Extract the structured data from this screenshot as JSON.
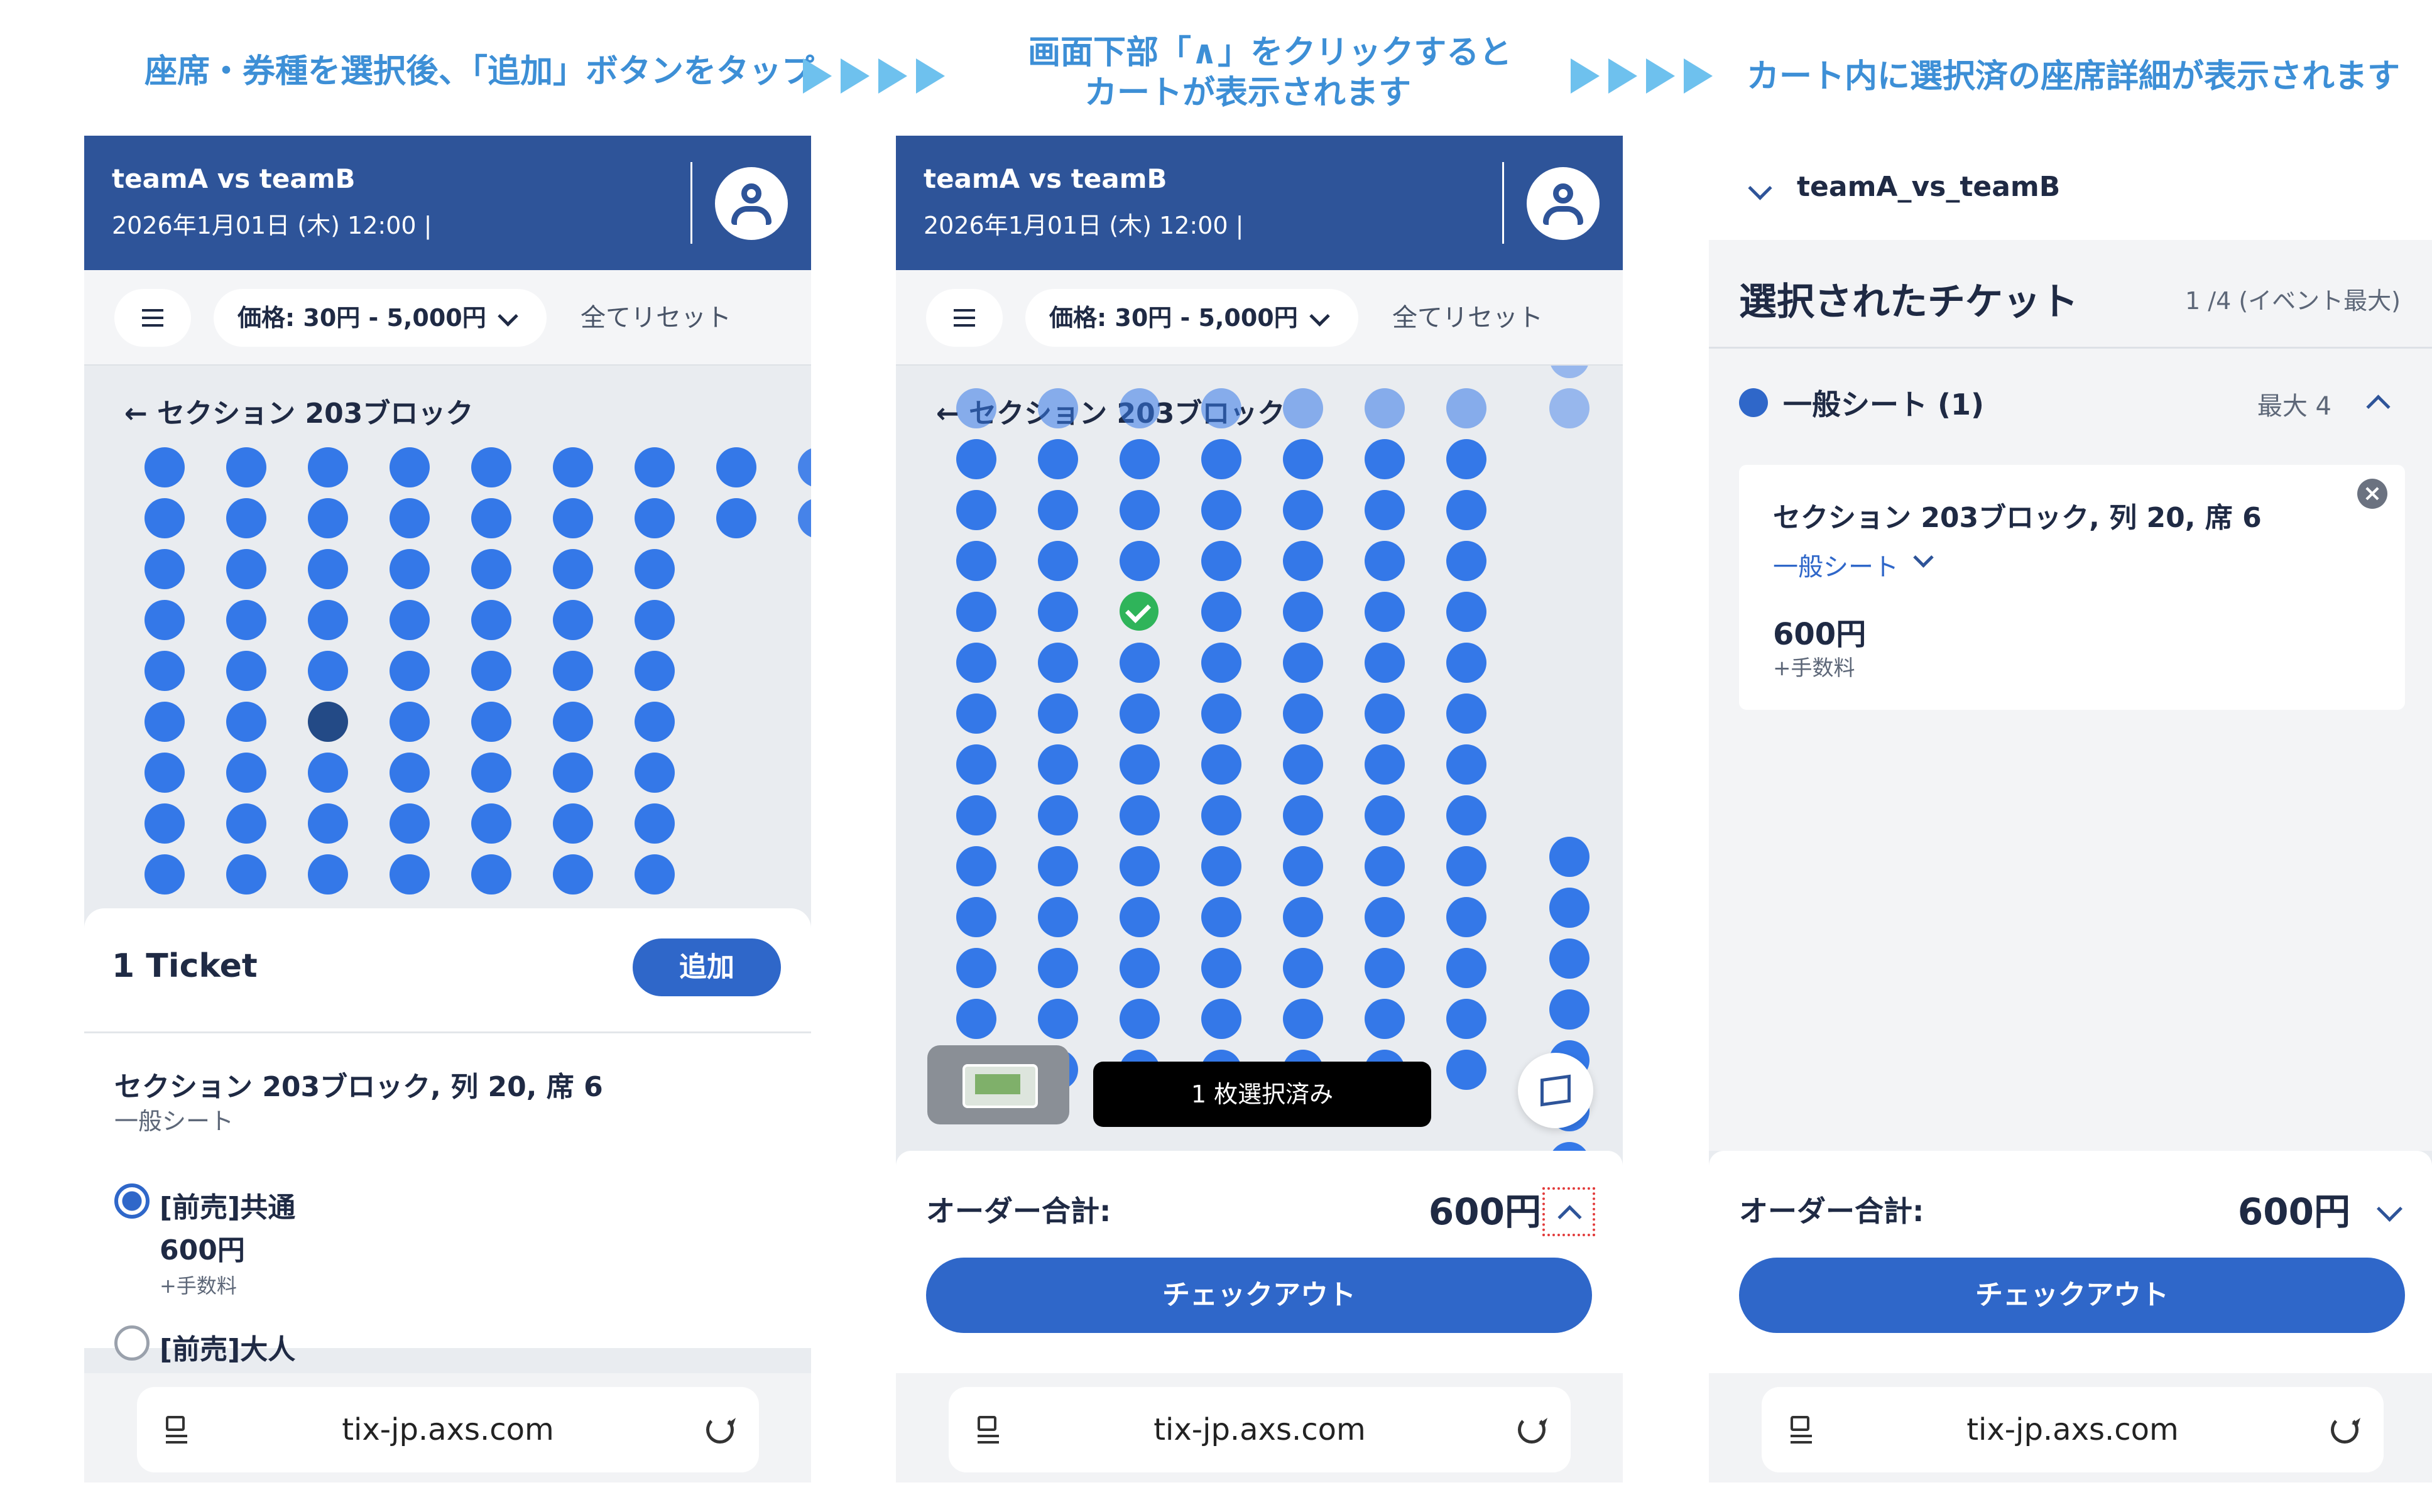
{
  "captions": {
    "step1": "座席・券種を選択後、「追加」ボタンをタップ",
    "step2_line1": "画面下部「∧」をクリックすると",
    "step2_line2": "カートが表示されます",
    "step3": "カート内に選択済の座席詳細が表示されます"
  },
  "event": {
    "title": "teamA vs teamB",
    "datetime": "2026年1月01日 (木) 12:00 |"
  },
  "filters": {
    "price": "価格: 30円 - 5,000円",
    "reset": "全てリセット"
  },
  "section_label": "← セクション 203ブロック",
  "ticket_sheet": {
    "title": "1 Ticket",
    "add_button": "追加",
    "seat": "セクション 203ブロック, 列 20, 席 6",
    "seat_type": "一般シート",
    "options": [
      {
        "label": "[前売]共通",
        "price": "600円",
        "fee": "+手数料",
        "selected": true
      },
      {
        "label": "[前売]大人",
        "selected": false
      }
    ]
  },
  "map_overlay": {
    "selected_count": "1 枚選択済み"
  },
  "order": {
    "label": "オーダー合計:",
    "total": "600円",
    "checkout": "チェックアウト"
  },
  "cart": {
    "event_title": "teamA_vs_teamB",
    "heading": "選択されたチケット",
    "count": "1 /4 (イベント最大)",
    "group_name": "一般シート (1)",
    "group_max": "最大 4",
    "item": {
      "seat": "セクション 203ブロック, 列 20, 席 6",
      "type": "一般シート",
      "price": "600円",
      "fee": "+手数料"
    }
  },
  "browser": {
    "url": "tix-jp.axs.com"
  },
  "colors": {
    "header": "#2e5499",
    "seat": "#3478e8",
    "button": "#2f67c9",
    "caption": "#3d8fd6"
  }
}
